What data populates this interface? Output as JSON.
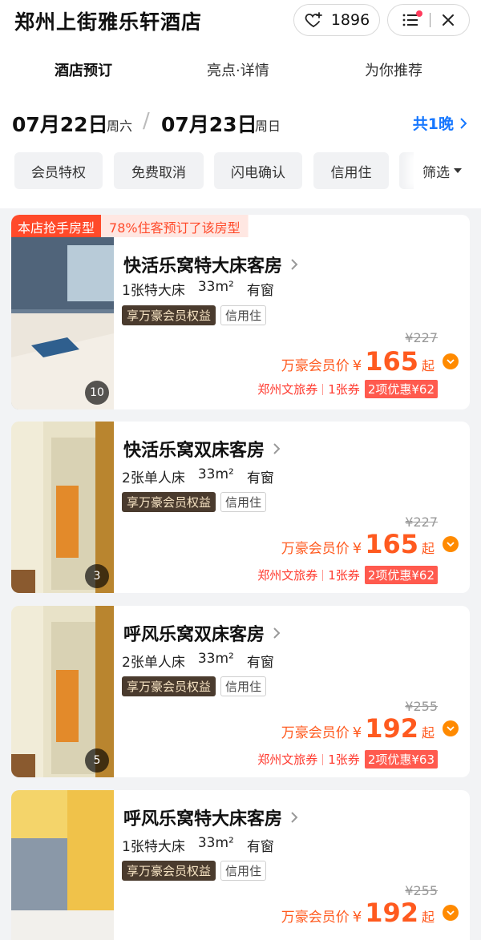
{
  "header": {
    "hotel_name": "郑州上街雅乐轩酒店",
    "favorites_count": "1896"
  },
  "tabs": [
    "酒店预订",
    "亮点·详情",
    "为你推荐"
  ],
  "dates": {
    "checkin": "07月22日",
    "checkin_weekday": "周六",
    "checkout": "07月23日",
    "checkout_weekday": "周日",
    "nights": "共1晚"
  },
  "filters": [
    "会员特权",
    "免费取消",
    "闪电确认",
    "信用住"
  ],
  "filter_button": "筛选",
  "rooms": [
    {
      "ribbon_left": "本店抢手房型",
      "ribbon_right": "78%住客预订了该房型",
      "name": "快活乐窝特大床客房",
      "bed": "1张特大床",
      "area": "33m²",
      "window": "有窗",
      "tag1": "享万豪会员权益",
      "tag2": "信用住",
      "orig_price": "¥227",
      "price_label": "万豪会员价",
      "currency": "¥",
      "price": "165",
      "price_suffix": "起",
      "coupon1": "郑州文旅券",
      "coupon2": "1张券",
      "coupon3": "2项优惠¥62",
      "photos": "10"
    },
    {
      "name": "快活乐窝双床客房",
      "bed": "2张单人床",
      "area": "33m²",
      "window": "有窗",
      "tag1": "享万豪会员权益",
      "tag2": "信用住",
      "orig_price": "¥227",
      "price_label": "万豪会员价",
      "currency": "¥",
      "price": "165",
      "price_suffix": "起",
      "coupon1": "郑州文旅券",
      "coupon2": "1张券",
      "coupon3": "2项优惠¥62",
      "photos": "3"
    },
    {
      "name": "呼风乐窝双床客房",
      "bed": "2张单人床",
      "area": "33m²",
      "window": "有窗",
      "tag1": "享万豪会员权益",
      "tag2": "信用住",
      "orig_price": "¥255",
      "price_label": "万豪会员价",
      "currency": "¥",
      "price": "192",
      "price_suffix": "起",
      "coupon1": "郑州文旅券",
      "coupon2": "1张券",
      "coupon3": "2项优惠¥63",
      "photos": "5"
    },
    {
      "name": "呼风乐窝特大床客房",
      "bed": "1张特大床",
      "area": "33m²",
      "window": "有窗",
      "tag1": "享万豪会员权益",
      "tag2": "信用住",
      "orig_price": "¥255",
      "price_label": "万豪会员价",
      "currency": "¥",
      "price": "192",
      "price_suffix": "起"
    }
  ]
}
